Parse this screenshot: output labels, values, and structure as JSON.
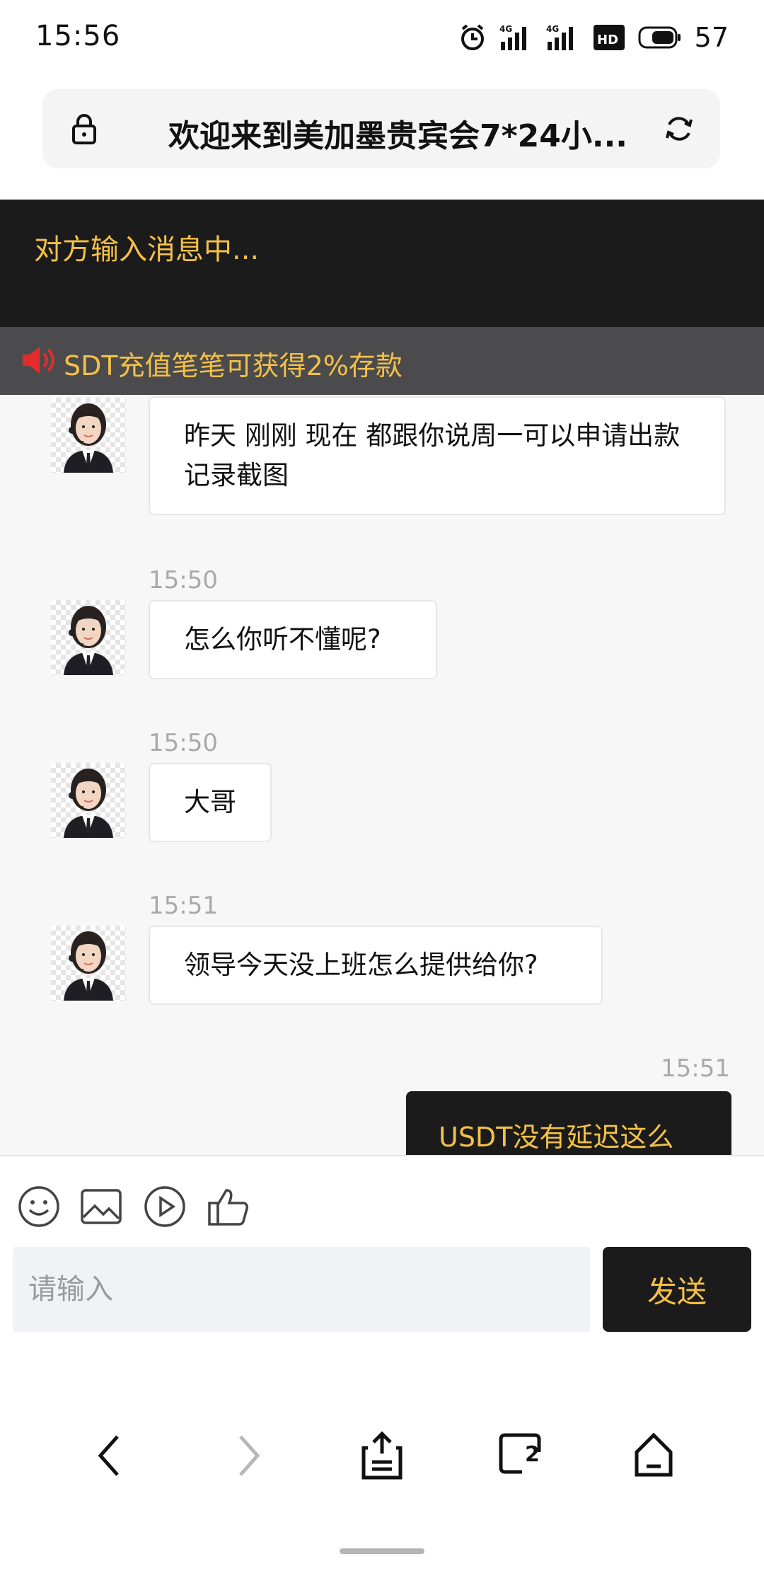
{
  "status_bar": {
    "time": "15:56",
    "battery": "57",
    "network_1": "4G",
    "network_2": "4G"
  },
  "browser": {
    "page_title": "欢迎来到美加墨贵宾会7*24小...",
    "tab_count": "2"
  },
  "chat": {
    "typing_status": "对方输入消息中...",
    "notice": "SDT充值笔笔可获得2%存款",
    "messages": [
      {
        "side": "agent",
        "text": "昨天 刚刚 现在 都跟你说周一可以申请出款记录截图"
      },
      {
        "side": "agent",
        "time": "15:50",
        "text": "怎么你听不懂呢?"
      },
      {
        "side": "agent",
        "time": "15:50",
        "text": "大哥"
      },
      {
        "side": "agent",
        "time": "15:51",
        "text": "领导今天没上班怎么提供给你?"
      },
      {
        "side": "user",
        "time": "15:51",
        "text": "USDT没有延迟这么久"
      }
    ]
  },
  "composer": {
    "placeholder": "请输入",
    "send_label": "发送"
  },
  "colors": {
    "accent_gold": "#f4c048",
    "dark": "#1b1b1b",
    "notice_bg": "#4b4b4d",
    "speaker_red": "#e52b2b"
  }
}
